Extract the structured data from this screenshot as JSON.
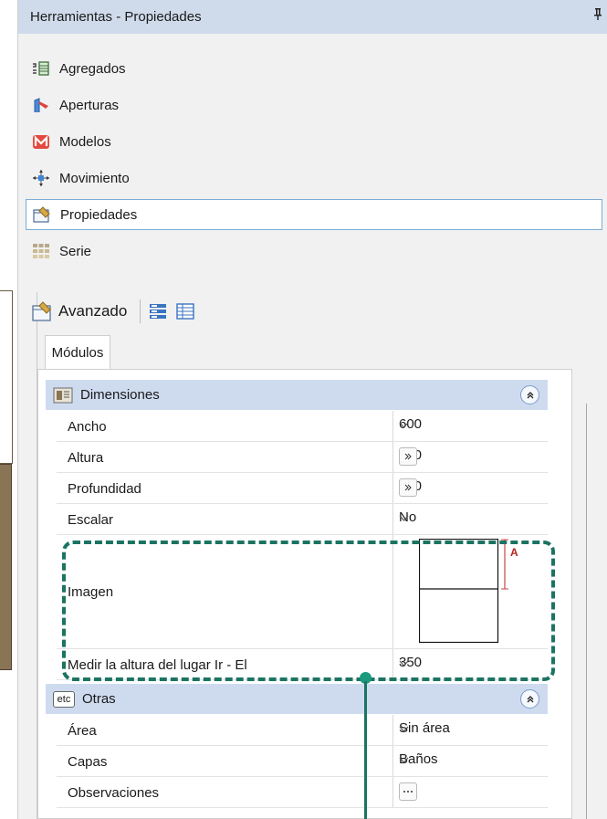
{
  "window": {
    "title": "Herramientas - Propiedades",
    "pin_glyph": "ᵻ"
  },
  "tools": [
    {
      "label": "Agregados",
      "icon": "aggregates-icon"
    },
    {
      "label": "Aperturas",
      "icon": "openings-icon"
    },
    {
      "label": "Modelos",
      "icon": "models-icon"
    },
    {
      "label": "Movimiento",
      "icon": "move-icon"
    },
    {
      "label": "Propiedades",
      "icon": "properties-icon",
      "selected": true
    },
    {
      "label": "Serie",
      "icon": "series-icon"
    }
  ],
  "advanced": {
    "label": "Avanzado"
  },
  "tab": {
    "label": "Módulos"
  },
  "groups": {
    "dimensiones": {
      "title": "Dimensiones",
      "rows": {
        "ancho": {
          "label": "Ancho",
          "value": "600"
        },
        "altura": {
          "label": "Altura",
          "value": "760"
        },
        "profundidad": {
          "label": "Profundidad",
          "value": "550"
        },
        "escalar": {
          "label": "Escalar",
          "value": "No"
        },
        "imagen": {
          "label": "Imagen",
          "marker": "A"
        },
        "medir": {
          "label": "Medir la altura del lugar Ir - El",
          "value": "350"
        }
      }
    },
    "otras": {
      "title": "Otras",
      "icon_text": "etc",
      "rows": {
        "area": {
          "label": "Área",
          "value": "Sin área"
        },
        "capas": {
          "label": "Capas",
          "value": "Baños"
        },
        "observaciones": {
          "label": "Observaciones",
          "value": ""
        }
      }
    }
  },
  "colors": {
    "header_blue": "#cedbef",
    "title_blue": "#cfdbeb",
    "highlight_green": "#1b7462",
    "selection_border": "#7dadd4"
  }
}
